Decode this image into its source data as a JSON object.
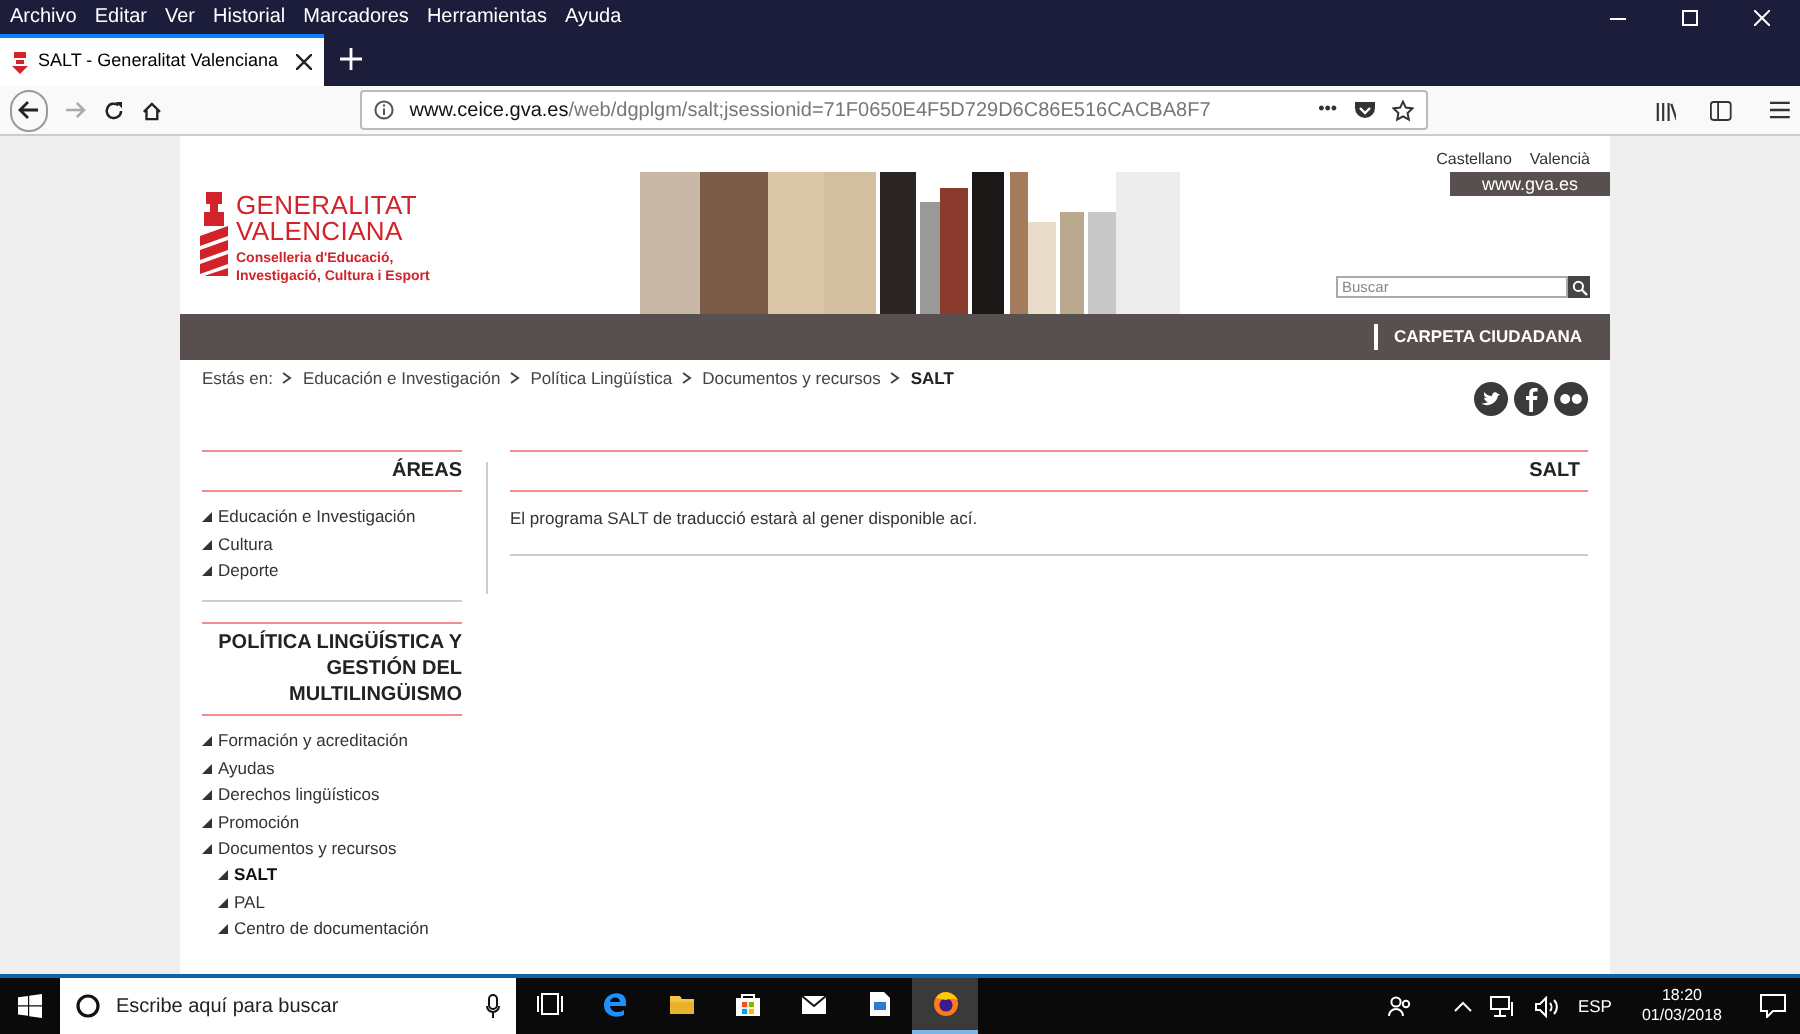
{
  "menu_bar": [
    "Archivo",
    "Editar",
    "Ver",
    "Historial",
    "Marcadores",
    "Herramientas",
    "Ayuda"
  ],
  "tabs": [
    {
      "title": "SALT - Generalitat Valenciana",
      "selected": true
    }
  ],
  "address_bar": {
    "url_host": "www.ceice.gva.es",
    "url_path": "/web/dgplgm/salt;jsessionid=71F0650E4F5D729D6C86E516CACBA8F7",
    "menu_glyph": "•••"
  },
  "header": {
    "languages": [
      "Castellano",
      "Valencià"
    ],
    "portal_link": "www.gva.es",
    "logo_title": [
      "GENERALITAT",
      "VALENCIANA"
    ],
    "logo_subtitle": [
      "Conselleria d'Educació,",
      "Investigació, Cultura i Esport"
    ],
    "search": {
      "placeholder": "Buscar"
    }
  },
  "nav_bar": {
    "link": "CARPETA CIUDADANA"
  },
  "breadcrumb": {
    "label": "Estás en:",
    "items": [
      {
        "text": "Educación e Investigación",
        "current": false
      },
      {
        "text": "Política Lingüística",
        "current": false
      },
      {
        "text": "Documentos y recursos",
        "current": false
      },
      {
        "text": "SALT",
        "current": true
      }
    ]
  },
  "sidebar": [
    {
      "title": "ÁREAS",
      "items": [
        {
          "label": "Educación e Investigación",
          "selected": false
        },
        {
          "label": "Cultura",
          "selected": false
        },
        {
          "label": "Deporte",
          "selected": false
        }
      ]
    },
    {
      "title": "POLÍTICA LINGÜÍSTICA Y GESTIÓN DEL MULTILINGÜISMO",
      "items": [
        {
          "label": "Formación y acreditación",
          "selected": false
        },
        {
          "label": "Ayudas",
          "selected": false
        },
        {
          "label": "Derechos lingüísticos",
          "selected": false
        },
        {
          "label": "Promoción",
          "selected": false
        },
        {
          "label": "Documentos y recursos",
          "selected": false,
          "children": [
            {
              "label": "SALT",
              "selected": true
            },
            {
              "label": "PAL",
              "selected": false
            },
            {
              "label": "Centro de documentación",
              "selected": false
            }
          ]
        }
      ]
    }
  ],
  "content": {
    "title": "SALT",
    "body": "El programa SALT de traducció estarà al gener disponible ací."
  },
  "taskbar": {
    "search_placeholder": "Escribe aquí para buscar",
    "language": "ESP",
    "time": "18:20",
    "date": "01/03/2018"
  }
}
